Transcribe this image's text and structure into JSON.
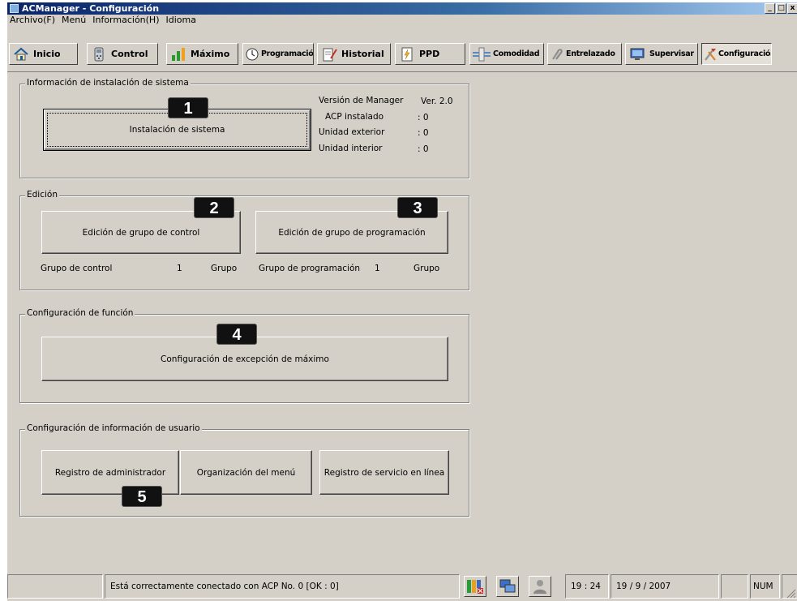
{
  "window": {
    "title": "ACManager - Configuración",
    "controls": [
      "_",
      "□",
      "x"
    ]
  },
  "menubar": {
    "items": [
      "Archivo(F)",
      "Menú",
      "Información(H)",
      "Idioma"
    ]
  },
  "toolbar": {
    "tabs": [
      {
        "label": "Inicio",
        "icon": "home-icon"
      },
      {
        "label": "Control",
        "icon": "remote-control-icon"
      },
      {
        "label": "Máximo",
        "icon": "bar-chart-icon"
      },
      {
        "label": "Programación",
        "icon": "clock-icon"
      },
      {
        "label": "Historial",
        "icon": "document-pencil-icon"
      },
      {
        "label": "PPD",
        "icon": "power-doc-icon"
      },
      {
        "label": "Comodidad",
        "icon": "comfort-icon"
      },
      {
        "label": "Entrelazado",
        "icon": "interlock-icon"
      },
      {
        "label": "Supervisar",
        "icon": "monitor-icon"
      },
      {
        "label": "Configuración",
        "icon": "tools-icon"
      }
    ],
    "active": "Configuración"
  },
  "install": {
    "group_title": "Información de instalación de sistema",
    "button_label": "Instalación de sistema",
    "manager_version_label": "Versión de Manager",
    "manager_version_value": "Ver. 2.0",
    "acp_label": "ACP instalado",
    "acp_value": ": 0",
    "outdoor_label": "Unidad exterior",
    "outdoor_value": ": 0",
    "indoor_label": "Unidad interior",
    "indoor_value": ": 0"
  },
  "edit": {
    "group_title": "Edición",
    "control_group_button": "Edición de grupo de control",
    "schedule_group_button": "Edición de grupo de programación",
    "control_group_label": "Grupo de control",
    "control_group_count": "1",
    "control_group_unit": "Grupo",
    "schedule_group_label": "Grupo de programación",
    "schedule_group_count": "1",
    "schedule_group_unit": "Grupo"
  },
  "function": {
    "group_title": "Configuración de función",
    "peak_exception_button": "Configuración de excepción  de máximo"
  },
  "user": {
    "group_title": "Configuración de información de usuario",
    "admin_register_button": "Registro de administrador",
    "menu_organization_button": "Organización del menú",
    "online_service_button": "Registro de servicio en línea"
  },
  "callouts": [
    "1",
    "2",
    "3",
    "4",
    "5"
  ],
  "statusbar": {
    "message": "Está correctamente conectado con ACP No. 0 [OK : 0]",
    "time": "19 : 24",
    "date": "19 / 9 / 2007",
    "num": "NUM"
  }
}
